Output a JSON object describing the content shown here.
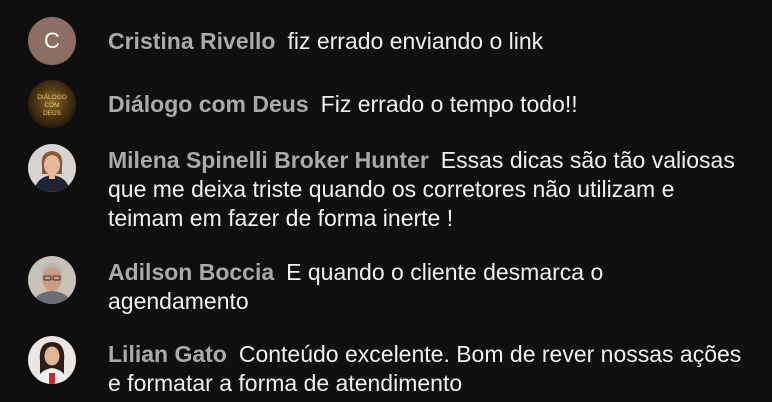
{
  "colors": {
    "background": "#0f0f0f",
    "author_name": "#aaaaaa",
    "message_text": "#f1f1f1",
    "letter_avatar_bg": "#8d6e63"
  },
  "messages": [
    {
      "author": "Cristina Rivello",
      "text": "fiz errado enviando o link",
      "avatar": {
        "type": "letter",
        "letter": "C"
      }
    },
    {
      "author": "Diálogo com Deus",
      "text": "Fiz errado o tempo todo!!",
      "avatar": {
        "type": "logo",
        "lines": [
          "DIÁLOGO",
          "COM",
          "DEUS"
        ]
      }
    },
    {
      "author": "Milena Spinelli Broker Hunter",
      "text": "Essas dicas são tão valiosas que me deixa triste quando os corretores não utilizam e teimam em fazer de forma inerte !",
      "avatar": {
        "type": "photo",
        "icon": "user-photo-icon"
      }
    },
    {
      "author": "Adilson Boccia",
      "text": "E quando o cliente desmarca o agendamento",
      "avatar": {
        "type": "photo",
        "icon": "user-photo-icon"
      }
    },
    {
      "author": "Lilian Gato",
      "text": "Conteúdo excelente. Bom de rever nossas ações e formatar a forma de atendimento",
      "avatar": {
        "type": "photo",
        "icon": "user-photo-icon"
      }
    }
  ]
}
